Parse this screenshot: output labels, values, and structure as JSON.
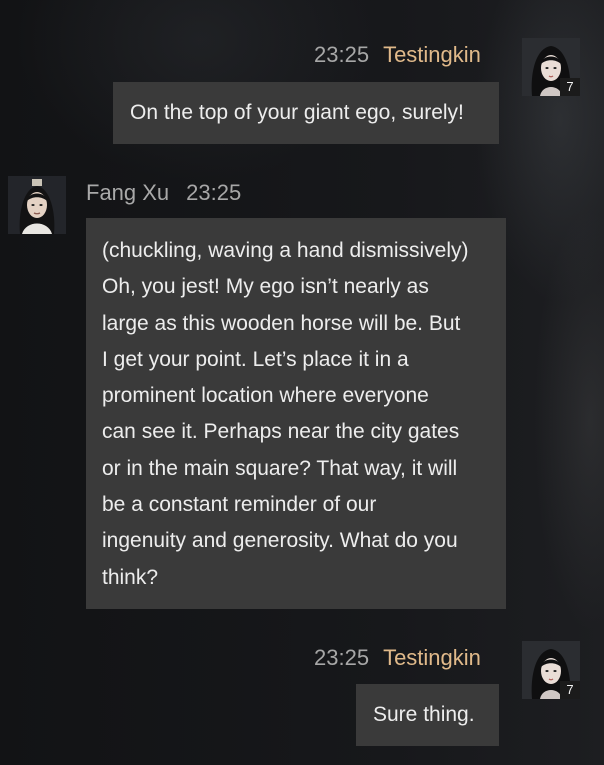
{
  "messages": [
    {
      "sender": "Testingkin",
      "time": "23:25",
      "text": "On the top of your giant ego, surely!",
      "avatar_level": "7"
    },
    {
      "sender": "Fang Xu",
      "time": "23:25",
      "lines": [
        "(chuckling, waving a hand dismissively)",
        "Oh, you jest! My ego isn’t nearly as",
        "large as this wooden horse will be. But",
        "I get your point. Let’s place it in a",
        "prominent location where everyone",
        "can see it. Perhaps near the city gates",
        "or in the main square? That way, it will",
        "be a constant reminder of our",
        "ingenuity and generosity. What do you",
        "think?"
      ]
    },
    {
      "sender": "Testingkin",
      "time": "23:25",
      "text": "Sure thing.",
      "avatar_level": "7"
    }
  ],
  "colors": {
    "background": "#141517",
    "bubble": "#3a3a3a",
    "bubble_text": "#ededed",
    "self_name": "#e0b98a",
    "other_name": "#a9a9a9",
    "timestamp": "#a7a7a7"
  },
  "icons": {
    "self_avatar": "female-character-portrait",
    "other_avatar": "male-character-portrait"
  }
}
